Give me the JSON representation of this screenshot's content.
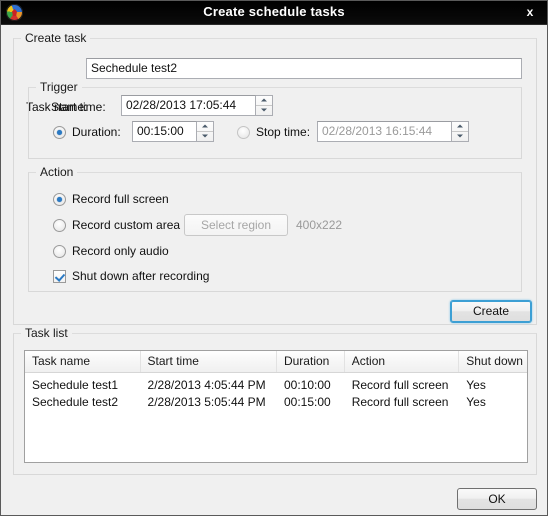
{
  "window": {
    "title": "Create schedule tasks",
    "icon": "media-disc-icon",
    "close_label": "x"
  },
  "create_task": {
    "legend": "Create task",
    "task_name_label": "Task name:",
    "task_name_value": "Sechedule test2",
    "task_name_placeholder": "",
    "trigger": {
      "legend": "Trigger",
      "start_time_label": "Start time:",
      "start_time_value": "02/28/2013 17:05:44",
      "duration_label": "Duration:",
      "duration_value": "00:15:00",
      "duration_selected": true,
      "stop_time_label": "Stop time:",
      "stop_time_value": "02/28/2013 16:15:44",
      "stop_time_selected": false
    },
    "action": {
      "legend": "Action",
      "record_full_screen_label": "Record full screen",
      "record_custom_area_label": "Record custom area",
      "select_region_label": "Select region",
      "region_size_label": "400x222",
      "record_only_audio_label": "Record only audio",
      "shut_down_label": "Shut down after recording",
      "selected_option": "record_full_screen",
      "shut_down_checked": true
    },
    "create_button_label": "Create"
  },
  "task_list": {
    "legend": "Task list",
    "columns": [
      "Task name",
      "Start time",
      "Duration",
      "Action",
      "Shut down"
    ],
    "rows": [
      {
        "task_name": "Sechedule test1",
        "start_time": "2/28/2013 4:05:44 PM",
        "duration": "00:10:00",
        "action": "Record full screen",
        "shut_down": "Yes"
      },
      {
        "task_name": "Sechedule test2",
        "start_time": "2/28/2013 5:05:44 PM",
        "duration": "00:15:00",
        "action": "Record full screen",
        "shut_down": "Yes"
      }
    ]
  },
  "footer": {
    "ok_label": "OK"
  },
  "colors": {
    "titlebar_bg": "#050505",
    "titlebar_text": "#ffffff",
    "dialog_bg": "#f0f0f0",
    "accent_focus": "#3c9fd4",
    "control_accent": "#2b7ac4",
    "disabled_text": "#9a9a9a"
  }
}
